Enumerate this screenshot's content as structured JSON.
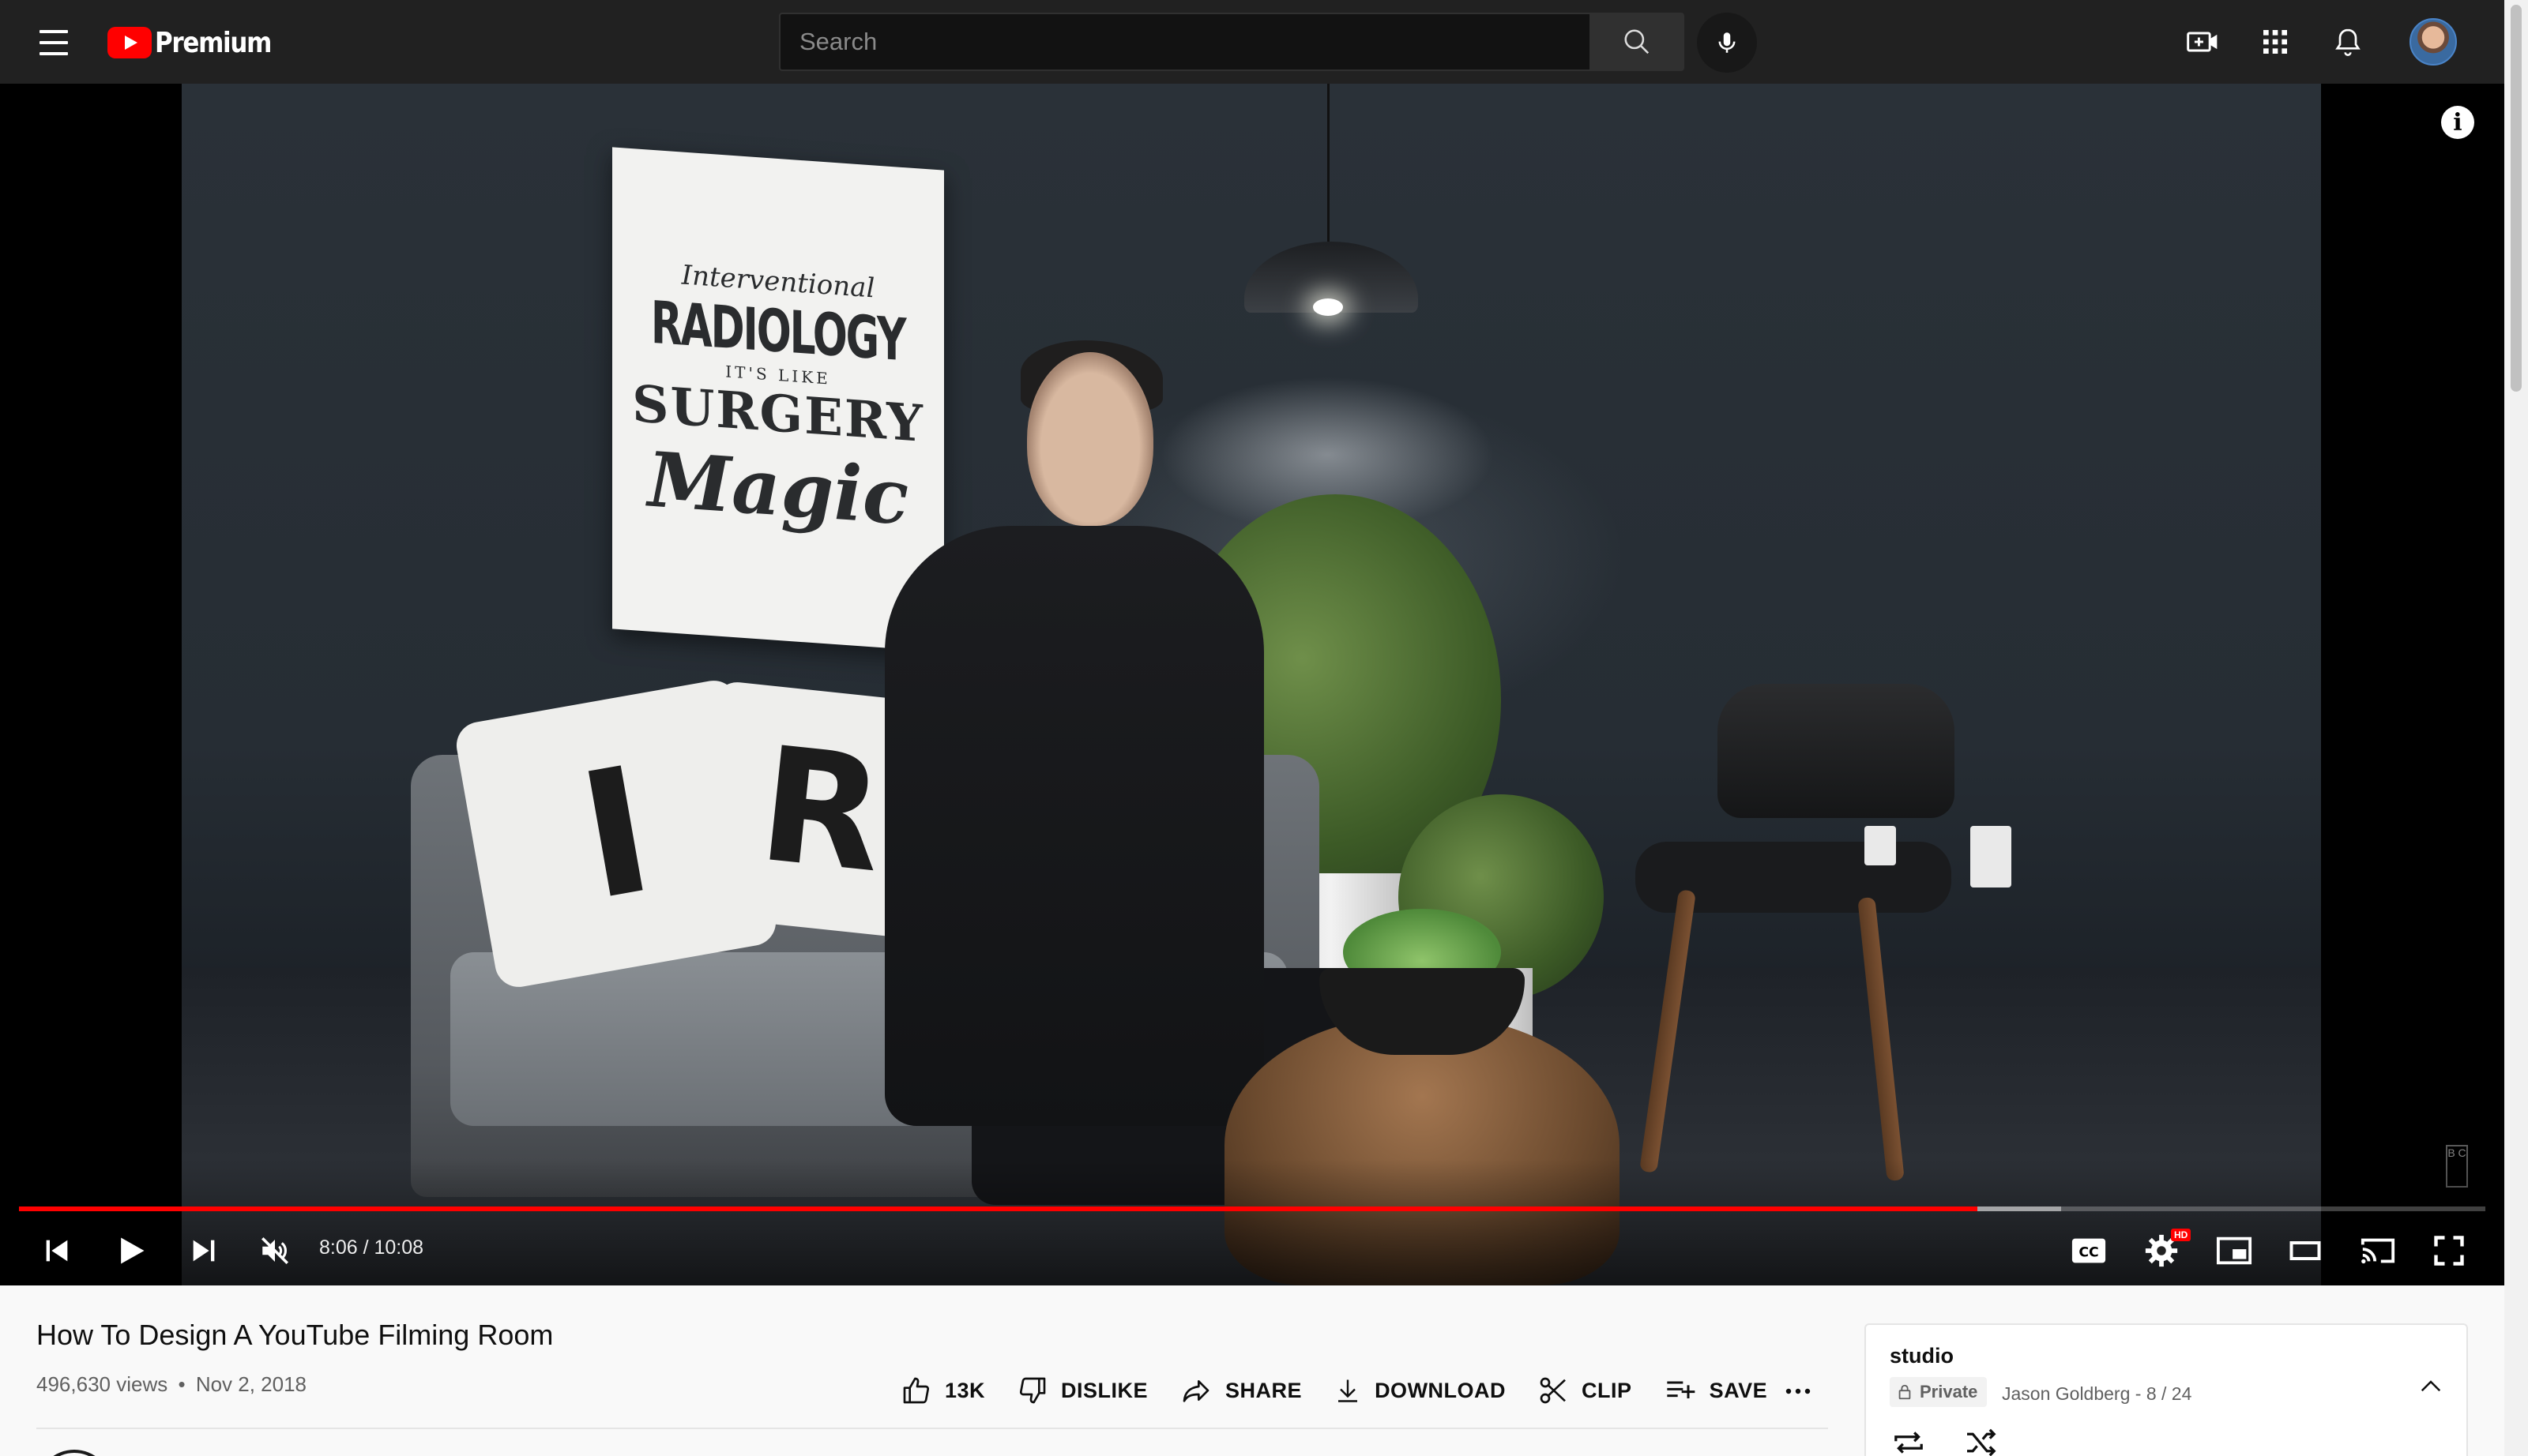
{
  "masthead": {
    "logo_text": "Premium",
    "search_placeholder": "Search"
  },
  "player": {
    "time_display": "8:06 / 10:08",
    "progress_played_fraction": 0.794,
    "progress_loaded_fraction": 0.828,
    "settings_badge": "HD",
    "poster": {
      "line1": "Interventional",
      "line2": "RADIOLOGY",
      "line3": "IT'S LIKE",
      "line4": "SURGERY",
      "line5": "Magic"
    },
    "pillow1_letter": "I",
    "pillow2_letter": "R",
    "watermark_text": "B C"
  },
  "video": {
    "title": "How To Design A YouTube Filming Room",
    "views": "496,630 views",
    "date": "Nov 2, 2018",
    "separator": "•"
  },
  "actions": {
    "like": "13K",
    "dislike": "DISLIKE",
    "share": "SHARE",
    "download": "DOWNLOAD",
    "clip": "CLIP",
    "save": "SAVE"
  },
  "playlist": {
    "title": "studio",
    "privacy": "Private",
    "owner_position": "Jason Goldberg - 8 / 24"
  },
  "colors": {
    "brand_red": "#ff0000",
    "masthead_bg": "#212121"
  }
}
